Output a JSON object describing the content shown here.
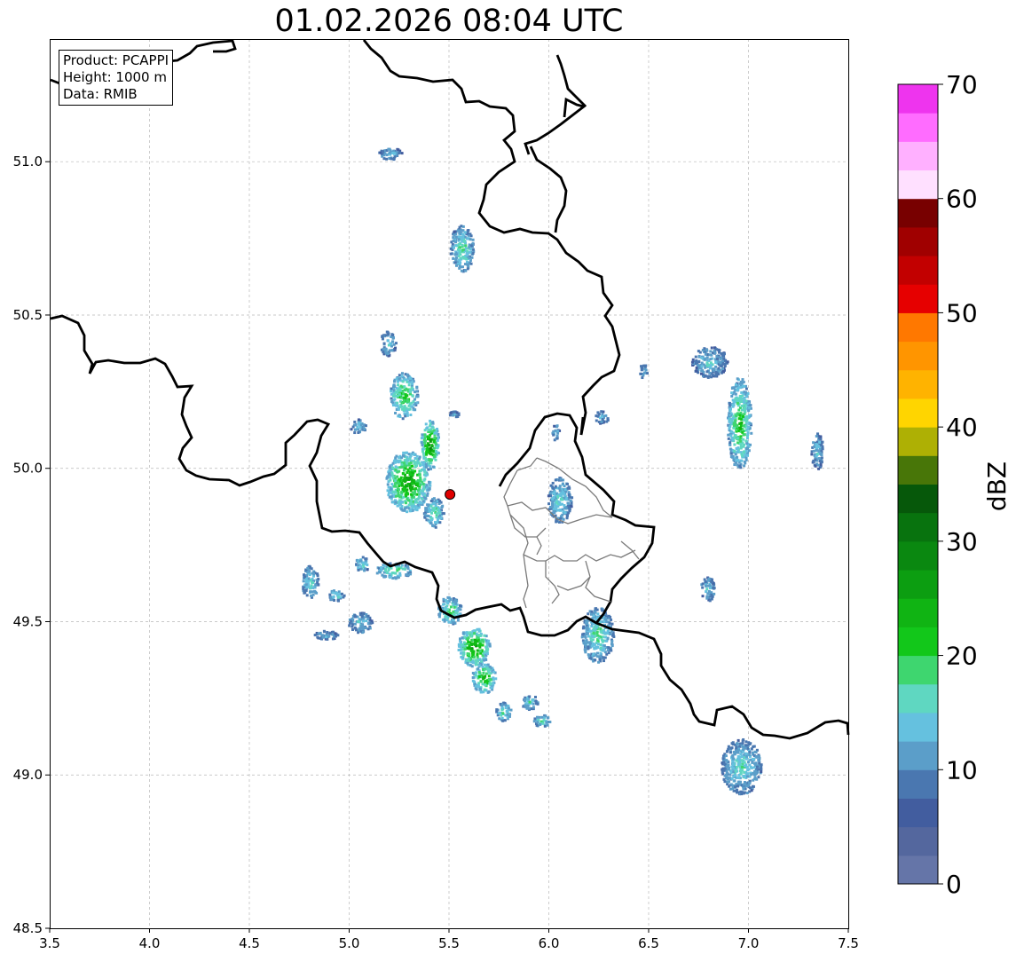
{
  "title": "01.02.2026 08:04 UTC",
  "info": {
    "product": "Product: PCAPPI",
    "height": "Height: 1000 m",
    "data": "Data: RMIB"
  },
  "axes": {
    "xlim": [
      3.5,
      7.5
    ],
    "ylim": [
      48.5,
      51.4
    ],
    "xticks": [
      "3.5",
      "4.0",
      "4.5",
      "5.0",
      "5.5",
      "6.0",
      "6.5",
      "7.0",
      "7.5"
    ],
    "yticks": [
      "48.5",
      "49.0",
      "49.5",
      "50.0",
      "50.5",
      "51.0"
    ],
    "grid": true
  },
  "radar_site": {
    "lon": 5.505,
    "lat": 49.915,
    "color": "#e00000"
  },
  "colorbar": {
    "label": "dBZ",
    "ticks": [
      "0",
      "10",
      "20",
      "30",
      "40",
      "50",
      "60",
      "70"
    ],
    "range": [
      0,
      70
    ],
    "colors": [
      "#6575a8",
      "#54679e",
      "#425d9f",
      "#4a77b0",
      "#5b9ec9",
      "#65c1df",
      "#5fd7c1",
      "#3ed66f",
      "#12c71a",
      "#10b413",
      "#0c9e11",
      "#0a8810",
      "#08730e",
      "#06580a",
      "#487608",
      "#aeb004",
      "#ffd500",
      "#ffb300",
      "#ff9500",
      "#ff7800",
      "#e60000",
      "#c20000",
      "#a00000",
      "#780000",
      "#ffe0ff",
      "#ffb0ff",
      "#ff6cff",
      "#ee34ee"
    ]
  },
  "echoes": [
    {
      "lon": 5.2,
      "lat": 51.03,
      "w": 0.12,
      "h": 0.04,
      "dbz": 10
    },
    {
      "lon": 5.56,
      "lat": 50.72,
      "w": 0.12,
      "h": 0.15,
      "dbz": 14
    },
    {
      "lon": 5.19,
      "lat": 50.41,
      "w": 0.08,
      "h": 0.08,
      "dbz": 10
    },
    {
      "lon": 5.27,
      "lat": 50.24,
      "w": 0.14,
      "h": 0.15,
      "dbz": 18
    },
    {
      "lon": 5.04,
      "lat": 50.14,
      "w": 0.08,
      "h": 0.05,
      "dbz": 10
    },
    {
      "lon": 5.4,
      "lat": 50.08,
      "w": 0.09,
      "h": 0.16,
      "dbz": 24
    },
    {
      "lon": 5.29,
      "lat": 49.96,
      "w": 0.22,
      "h": 0.2,
      "dbz": 22
    },
    {
      "lon": 5.42,
      "lat": 49.86,
      "w": 0.1,
      "h": 0.1,
      "dbz": 14
    },
    {
      "lon": 5.06,
      "lat": 49.69,
      "w": 0.07,
      "h": 0.05,
      "dbz": 12
    },
    {
      "lon": 5.22,
      "lat": 49.67,
      "w": 0.18,
      "h": 0.05,
      "dbz": 16
    },
    {
      "lon": 4.8,
      "lat": 49.63,
      "w": 0.08,
      "h": 0.12,
      "dbz": 12
    },
    {
      "lon": 4.93,
      "lat": 49.59,
      "w": 0.08,
      "h": 0.04,
      "dbz": 12
    },
    {
      "lon": 5.05,
      "lat": 49.5,
      "w": 0.12,
      "h": 0.07,
      "dbz": 10
    },
    {
      "lon": 4.88,
      "lat": 49.46,
      "w": 0.12,
      "h": 0.03,
      "dbz": 8
    },
    {
      "lon": 5.5,
      "lat": 49.54,
      "w": 0.12,
      "h": 0.09,
      "dbz": 16
    },
    {
      "lon": 5.62,
      "lat": 49.42,
      "w": 0.16,
      "h": 0.13,
      "dbz": 22
    },
    {
      "lon": 5.67,
      "lat": 49.32,
      "w": 0.12,
      "h": 0.1,
      "dbz": 20
    },
    {
      "lon": 5.77,
      "lat": 49.21,
      "w": 0.08,
      "h": 0.06,
      "dbz": 14
    },
    {
      "lon": 5.9,
      "lat": 49.24,
      "w": 0.08,
      "h": 0.05,
      "dbz": 12
    },
    {
      "lon": 5.96,
      "lat": 49.18,
      "w": 0.08,
      "h": 0.04,
      "dbz": 14
    },
    {
      "lon": 6.05,
      "lat": 49.9,
      "w": 0.12,
      "h": 0.15,
      "dbz": 12
    },
    {
      "lon": 6.03,
      "lat": 50.12,
      "w": 0.04,
      "h": 0.05,
      "dbz": 10
    },
    {
      "lon": 6.24,
      "lat": 49.46,
      "w": 0.16,
      "h": 0.18,
      "dbz": 14
    },
    {
      "lon": 6.26,
      "lat": 50.17,
      "w": 0.07,
      "h": 0.04,
      "dbz": 8
    },
    {
      "lon": 6.47,
      "lat": 50.32,
      "w": 0.04,
      "h": 0.05,
      "dbz": 10
    },
    {
      "lon": 6.8,
      "lat": 50.35,
      "w": 0.18,
      "h": 0.1,
      "dbz": 10
    },
    {
      "lon": 6.95,
      "lat": 50.15,
      "w": 0.12,
      "h": 0.3,
      "dbz": 18
    },
    {
      "lon": 7.34,
      "lat": 50.06,
      "w": 0.06,
      "h": 0.12,
      "dbz": 10
    },
    {
      "lon": 6.79,
      "lat": 49.61,
      "w": 0.07,
      "h": 0.08,
      "dbz": 10
    },
    {
      "lon": 6.96,
      "lat": 49.03,
      "w": 0.2,
      "h": 0.18,
      "dbz": 12
    },
    {
      "lon": 5.52,
      "lat": 50.18,
      "w": 0.05,
      "h": 0.02,
      "dbz": 10
    }
  ]
}
